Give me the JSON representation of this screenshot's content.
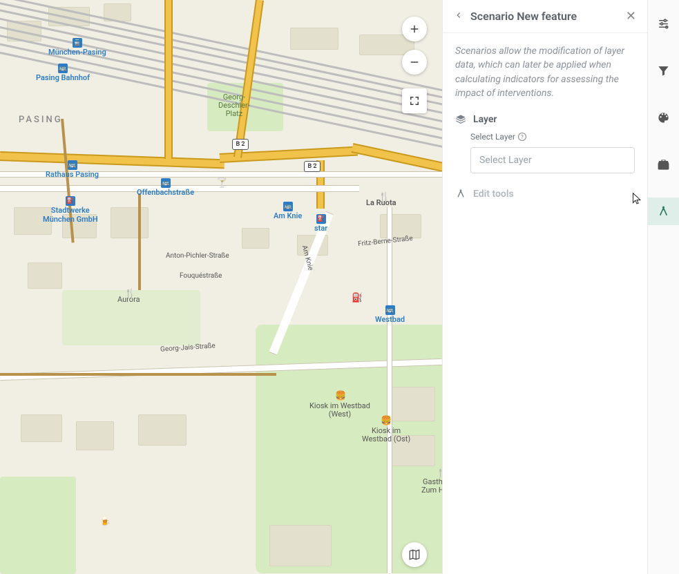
{
  "panel": {
    "title": "Scenario New feature",
    "description": "Scenarios allow the modification of layer data, which can later be applied when calculating indicators for assessing the impact of interventions.",
    "layer_section": "Layer",
    "select_label": "Select Layer",
    "select_placeholder": "Select Layer",
    "edit_tools": "Edit tools"
  },
  "toolrail": {
    "items": [
      "settings",
      "filter",
      "palette",
      "toolbox",
      "scenario"
    ],
    "active": "scenario"
  },
  "map": {
    "area_label": "PASING",
    "road_shield": "B 2",
    "pois": {
      "muenchen_pasing": "München-Pasing",
      "pasing_bahnhof": "Pasing Bahnhof",
      "rathaus_pasing": "Rathaus Pasing",
      "stadtwerke": "Stadtwerke\nMünchen GmbH",
      "offenbach": "Offenbachstraße",
      "am_knie": "Am Knie",
      "la_ruota": "La Ruota",
      "star": "star",
      "westbad": "Westbad"
    },
    "streets": {
      "anton_pichler": "Anton-Pichler-Straße",
      "fouque": "Fouquéstraße",
      "am_knie": "Am Knie",
      "fritz_berne": "Fritz-Berne-Straße",
      "georg_jais": "Georg-Jais-Straße"
    },
    "park_labels": {
      "deschler": "Georg-\nDeschler-\nPlatz",
      "aurora": "Aurora",
      "kiosk_west": "Kiosk im Westbad\n(West)",
      "kiosk_ost": "Kiosk im\nWestbad (Ost)",
      "gasthaus": "Gasth\nZum H"
    }
  }
}
